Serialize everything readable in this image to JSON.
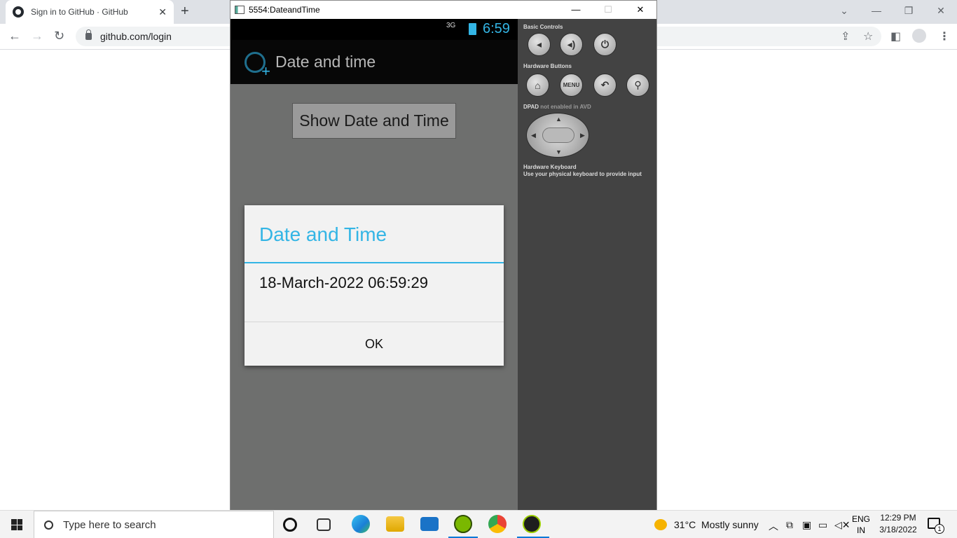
{
  "browser": {
    "tab_title": "Sign in to GitHub · GitHub",
    "url": "github.com/login"
  },
  "emulator": {
    "window_title": "5554:DateandTime",
    "status_clock": "6:59",
    "signal_label": "3G",
    "app_title": "Date and time",
    "show_button_label": "Show Date and Time",
    "dialog": {
      "title": "Date and Time",
      "message": "18-March-2022 06:59:29",
      "ok_label": "OK"
    },
    "panel": {
      "basic_controls": "Basic Controls",
      "hardware_buttons": "Hardware Buttons",
      "menu_label": "MENU",
      "dpad_label": "DPAD",
      "dpad_note": " not enabled in AVD",
      "keyboard_title": "Hardware Keyboard",
      "keyboard_note": "Use your physical keyboard to provide input"
    }
  },
  "taskbar": {
    "search_placeholder": "Type here to search",
    "weather": "31°C  Mostly sunny",
    "lang_top": "ENG",
    "lang_bottom": "IN",
    "time": "12:29 PM",
    "date": "3/18/2022",
    "notif_count": "1"
  },
  "colors": {
    "accent": "#33b5e5",
    "panel_bg": "#434343"
  }
}
